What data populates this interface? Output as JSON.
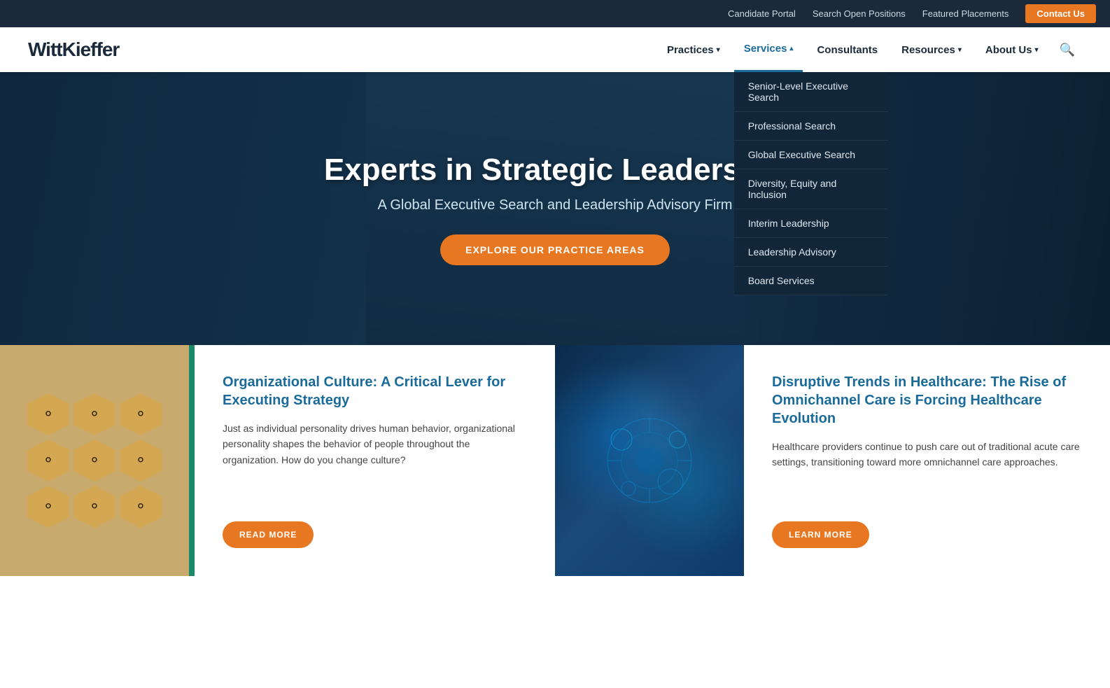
{
  "topbar": {
    "candidate_portal": "Candidate Portal",
    "search_open_positions": "Search Open Positions",
    "featured_placements": "Featured Placements",
    "contact_us": "Contact Us"
  },
  "nav": {
    "logo": "WittKieffer",
    "items": [
      {
        "label": "Practices",
        "has_dropdown": true,
        "active": false
      },
      {
        "label": "Services",
        "has_dropdown": true,
        "active": true
      },
      {
        "label": "Consultants",
        "has_dropdown": false,
        "active": false
      },
      {
        "label": "Resources",
        "has_dropdown": true,
        "active": false
      },
      {
        "label": "About Us",
        "has_dropdown": true,
        "active": false
      }
    ],
    "services_dropdown": [
      {
        "label": "Senior-Level Executive Search"
      },
      {
        "label": "Professional Search"
      },
      {
        "label": "Global Executive Search"
      },
      {
        "label": "Diversity, Equity and Inclusion"
      },
      {
        "label": "Interim Leadership"
      },
      {
        "label": "Leadership Advisory"
      },
      {
        "label": "Board Services"
      }
    ]
  },
  "hero": {
    "title": "Experts in Strategic Leadership",
    "subtitle": "A Global Executive Search and Leadership Advisory Firm",
    "cta_button": "EXPLORE OUR PRACTICE AREAS"
  },
  "cards": [
    {
      "title": "Organizational Culture: A Critical Lever for Executing Strategy",
      "text": "Just as individual personality drives human behavior, organizational personality shapes the behavior of people throughout the organization. How do you change culture?",
      "button": "READ MORE",
      "image_type": "hex"
    },
    {
      "title": "Disruptive Trends in Healthcare: The Rise of Omnichannel Care is Forcing Healthcare Evolution",
      "text": "Healthcare providers continue to push care out of traditional acute care settings, transitioning toward more omnichannel care approaches.",
      "button": "LEARN MORE",
      "image_type": "tech"
    }
  ],
  "icons": {
    "person": "👤",
    "search": "🔍",
    "arrow_down": "▾",
    "arrow_up": "▴"
  }
}
